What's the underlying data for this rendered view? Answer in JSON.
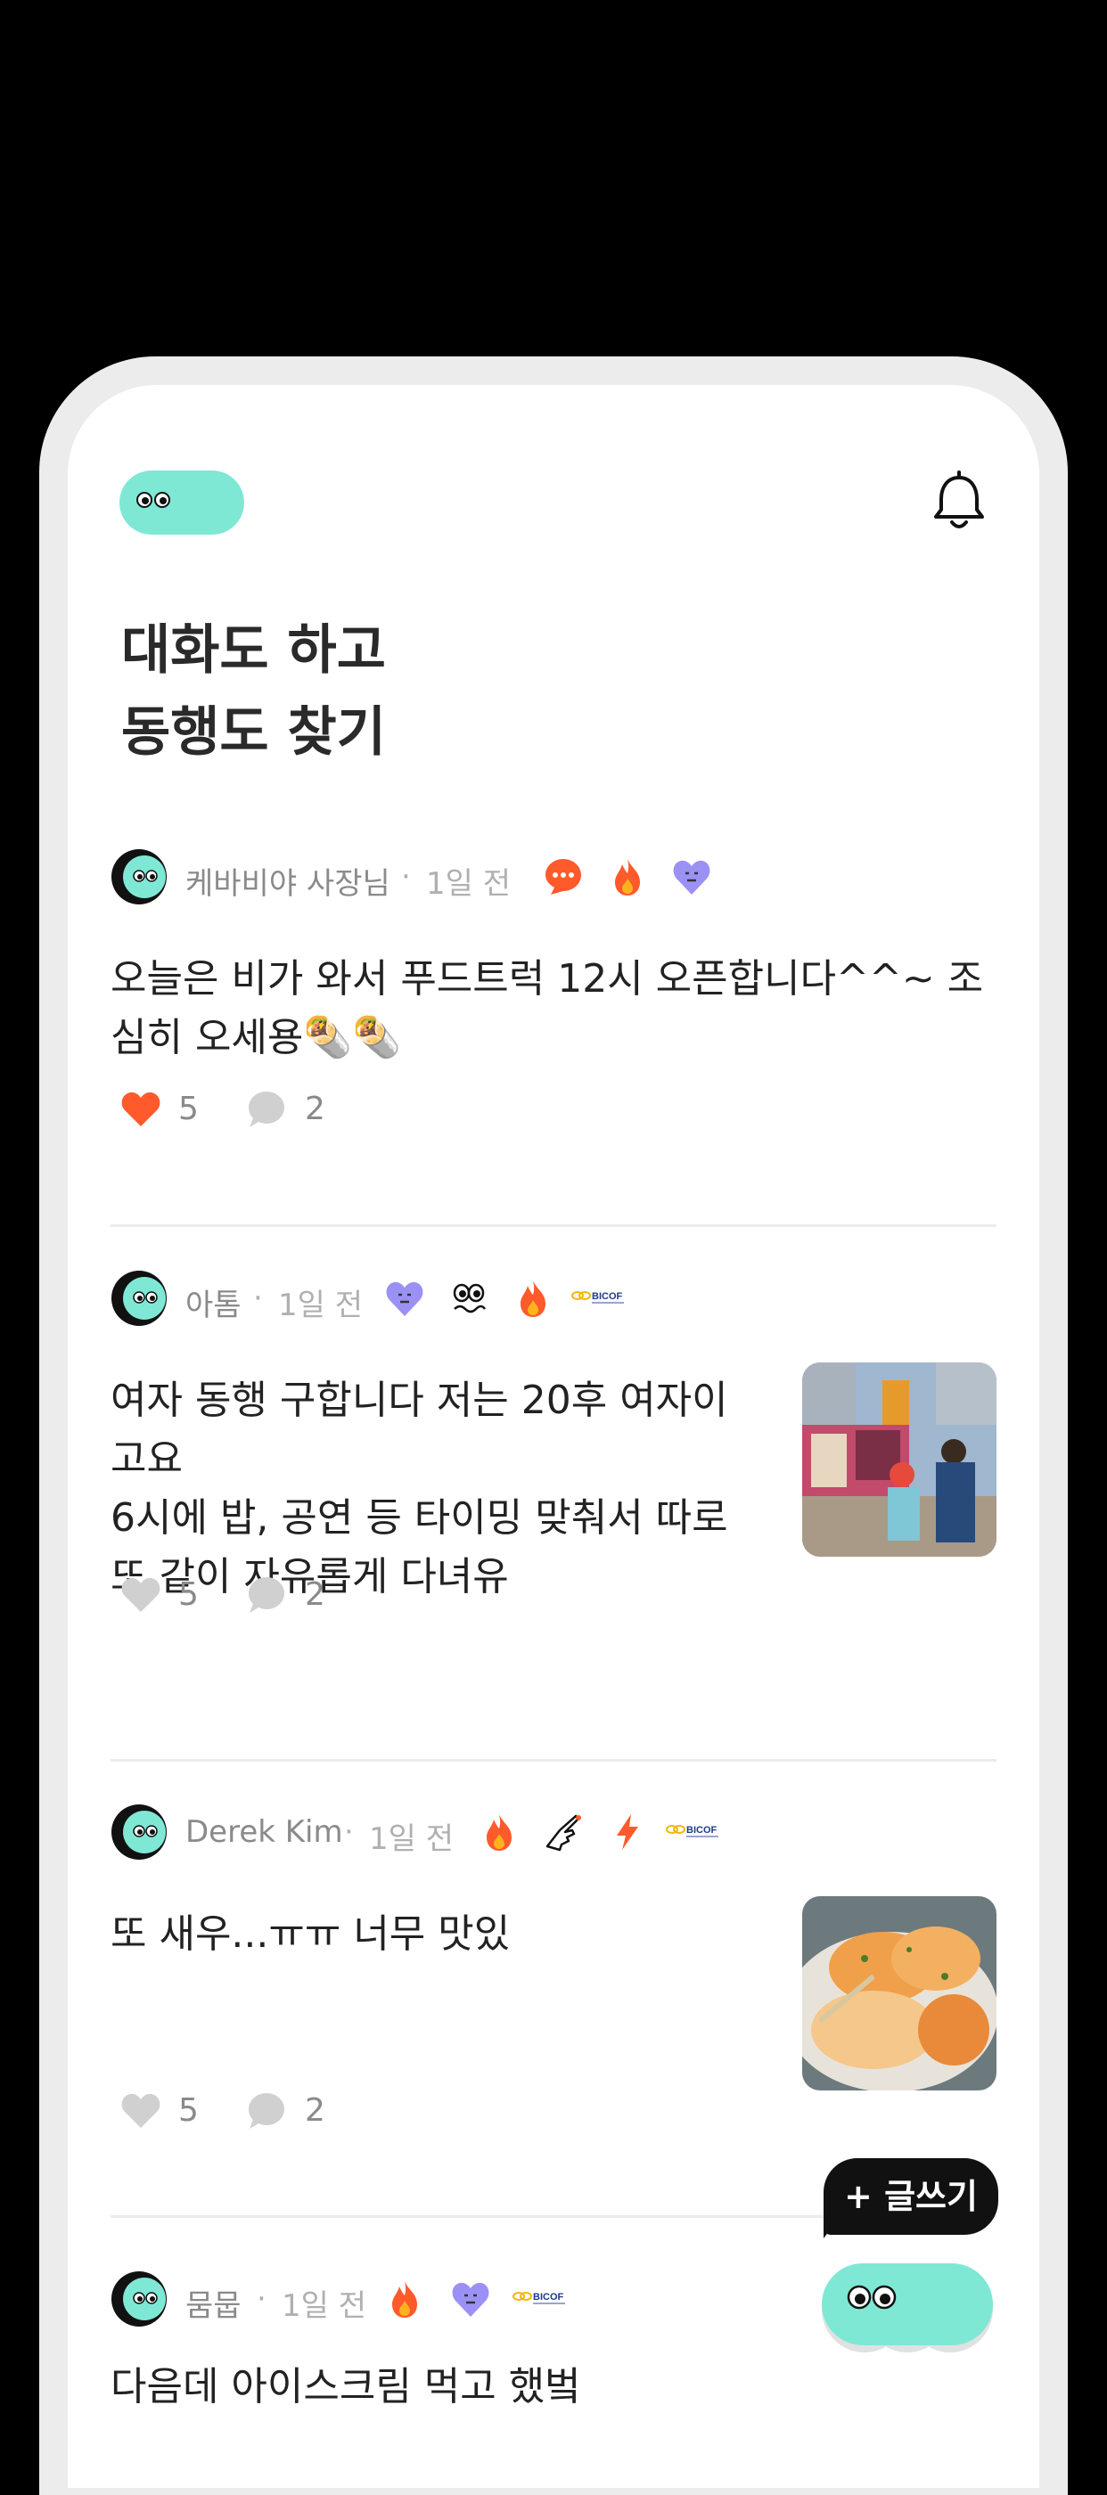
{
  "headline": {
    "line1": "대화도 하고",
    "line2": "동행도 찾기"
  },
  "colors": {
    "brand_mint": "#7ee8d5",
    "like_active": "#ff5a2c",
    "icon_gray": "#d0d0d0",
    "text_meta": "#8a8a8a"
  },
  "posts": [
    {
      "author": "케바비야 사장님",
      "time": "1일 전",
      "badges": [
        "chat-bubble-badge",
        "fire-badge",
        "purple-heart-badge"
      ],
      "text": "오늘은 비가 와서 푸드트럭 12시 오픈합니다^^~ 조심히 오세용🌯🌯",
      "liked": true,
      "likes": "5",
      "comments": "2"
    },
    {
      "author": "아톰",
      "time": "1일 전",
      "badges": [
        "purple-heart-badge",
        "eyes-badge",
        "fire-badge",
        "bicof-badge"
      ],
      "text": "여자 동행 구합니다 저는 20후 여자이고요\n6시에 밥, 공연 등 타이밍 맞춰서 따로 또 같이 자유롭게 다녀유",
      "thumbnail": "festival-street-photo",
      "liked": false,
      "likes": "5",
      "comments": "2"
    },
    {
      "author": "Derek Kim",
      "time": "1일 전",
      "badges": [
        "fire-badge",
        "pointing-hand-badge",
        "lightning-badge",
        "bicof-badge"
      ],
      "text": "또 새우...ㅠㅠ 너무 맛있",
      "thumbnail": "grilled-shrimp-photo",
      "liked": false,
      "likes": "5",
      "comments": "2"
    },
    {
      "author": "뭄뭅",
      "time": "1일 전",
      "badges": [
        "fire-badge",
        "purple-heart-badge",
        "bicof-badge"
      ],
      "text": "다음데 아이스크림 먹고 했벜"
    }
  ],
  "badge_text": {
    "bicof": "BICOF"
  },
  "fab": {
    "label": "+ 글쓰기"
  }
}
